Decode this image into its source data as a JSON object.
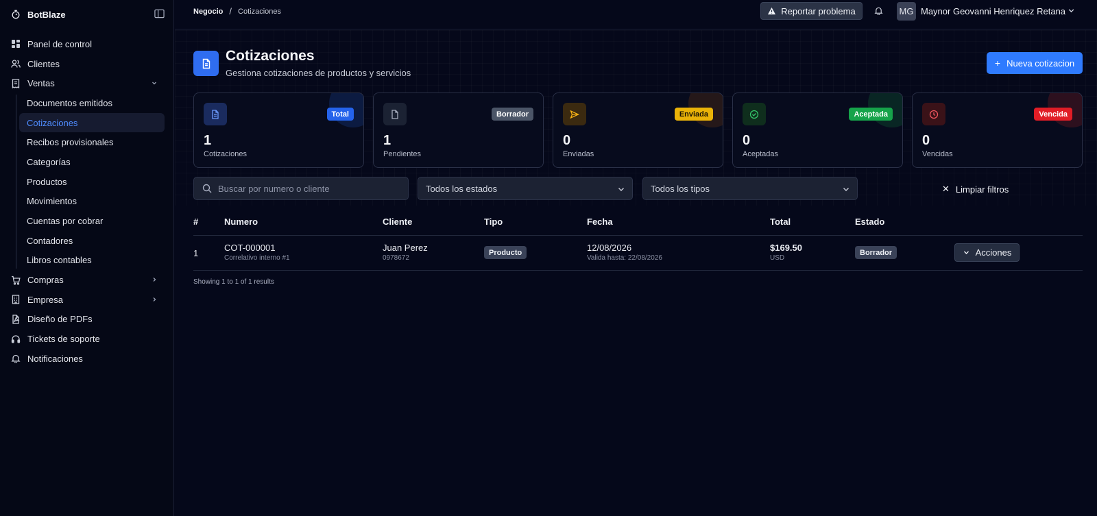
{
  "app": {
    "brand": "BotBlaze"
  },
  "sidebar": {
    "items": [
      {
        "label": "Panel de control",
        "icon": "dashboard-icon"
      },
      {
        "label": "Clientes",
        "icon": "users-icon"
      },
      {
        "label": "Ventas",
        "icon": "receipt-icon",
        "expanded": true
      },
      {
        "label": "Compras",
        "icon": "cart-icon"
      },
      {
        "label": "Empresa",
        "icon": "building-icon"
      },
      {
        "label": "Diseño de PDFs",
        "icon": "pdf-icon"
      },
      {
        "label": "Tickets de soporte",
        "icon": "headset-icon"
      },
      {
        "label": "Notificaciones",
        "icon": "bell-icon"
      }
    ],
    "ventas_sub": [
      "Documentos emitidos",
      "Cotizaciones",
      "Recibos provisionales",
      "Categorías",
      "Productos",
      "Movimientos",
      "Cuentas por cobrar",
      "Contadores",
      "Libros contables"
    ],
    "active": "Cotizaciones"
  },
  "topbar": {
    "breadcrumb": [
      "Negocio",
      "Cotizaciones"
    ],
    "report_label": "Reportar problema",
    "avatar_initials": "MG",
    "user_name": "Maynor Geovanni Henriquez Retana"
  },
  "page": {
    "title": "Cotizaciones",
    "subtitle": "Gestiona cotizaciones de productos y servicios",
    "new_button": "Nueva cotizacion"
  },
  "stats": [
    {
      "badge": "Total",
      "value": "1",
      "label": "Cotizaciones",
      "color": "#2563eb"
    },
    {
      "badge": "Borrador",
      "value": "1",
      "label": "Pendientes",
      "color": "#4b5567"
    },
    {
      "badge": "Enviada",
      "value": "0",
      "label": "Enviadas",
      "color": "#eab308"
    },
    {
      "badge": "Aceptada",
      "value": "0",
      "label": "Aceptadas",
      "color": "#16a34a"
    },
    {
      "badge": "Vencida",
      "value": "0",
      "label": "Vencidas",
      "color": "#dc2626"
    }
  ],
  "filters": {
    "search_placeholder": "Buscar por numero o cliente",
    "status_select": "Todos los estados",
    "type_select": "Todos los tipos",
    "clear_label": "Limpiar filtros"
  },
  "table": {
    "headers": [
      "#",
      "Numero",
      "Cliente",
      "Tipo",
      "Fecha",
      "Total",
      "Estado"
    ],
    "rows": [
      {
        "index": "1",
        "number": "COT-000001",
        "number_sub": "Correlativo interno #1",
        "client": "Juan Perez",
        "client_sub": "0978672",
        "type": "Producto",
        "date": "12/08/2026",
        "date_sub": "Valida hasta: 22/08/2026",
        "total": "$169.50",
        "currency": "USD",
        "status": "Borrador",
        "actions_label": "Acciones"
      }
    ],
    "showing": "Showing 1 to 1 of 1 results"
  }
}
